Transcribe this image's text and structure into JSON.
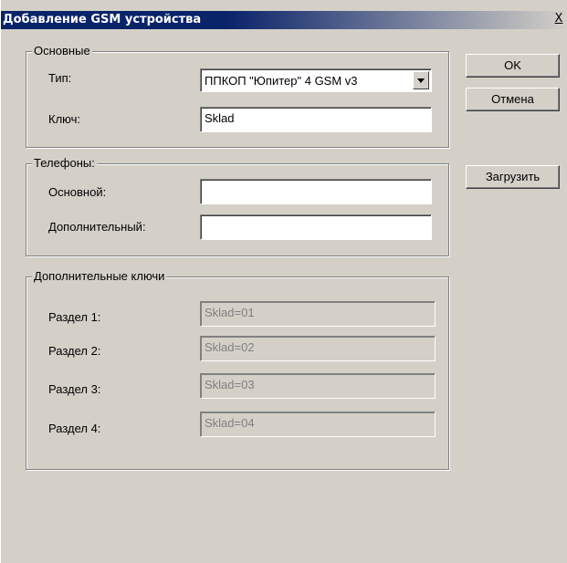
{
  "window": {
    "title": "Добавление GSM устройства",
    "close_label": "X"
  },
  "basic": {
    "legend": "Основные",
    "type_label": "Тип:",
    "type_value": "ППКОП \"Юпитер\" 4 GSM v3",
    "key_label": "Ключ:",
    "key_value": "Sklad"
  },
  "phones": {
    "legend": "Телефоны:",
    "main_label": "Основной:",
    "main_value": "",
    "extra_label": "Дополнительный:",
    "extra_value": ""
  },
  "extra_keys": {
    "legend": "Дополнительные ключи",
    "sections": [
      {
        "label": "Раздел 1:",
        "value": "Sklad=01"
      },
      {
        "label": "Раздел 2:",
        "value": "Sklad=02"
      },
      {
        "label": "Раздел 3:",
        "value": "Sklad=03"
      },
      {
        "label": "Раздел 4:",
        "value": "Sklad=04"
      }
    ]
  },
  "buttons": {
    "ok": "OK",
    "cancel": "Отмена",
    "load": "Загрузить"
  }
}
